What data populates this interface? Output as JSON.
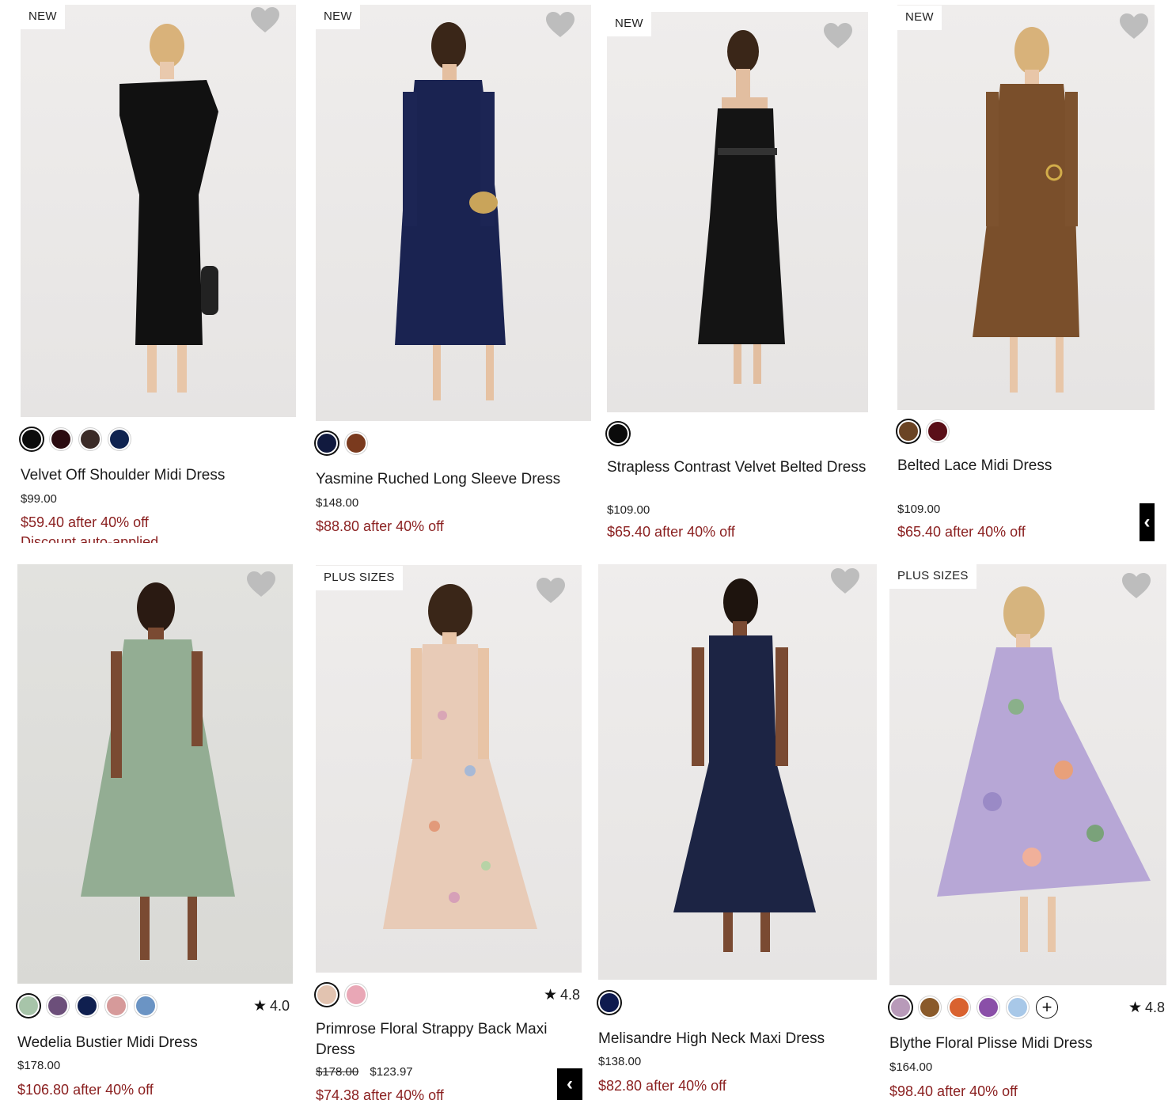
{
  "products": [
    {
      "badge": "NEW",
      "name": "Velvet Off Shoulder Midi Dress",
      "price": "$99.00",
      "sale": "$59.40 after 40% off",
      "extra": "Discount auto-applied",
      "swatches": [
        "#0d0d0d",
        "#2a0b10",
        "#3b2b27",
        "#0f2350"
      ],
      "dress_color": "#101010"
    },
    {
      "badge": "NEW",
      "name": "Yasmine Ruched Long Sleeve Dress",
      "price": "$148.00",
      "sale": "$88.80 after 40% off",
      "swatches": [
        "#111a3f",
        "#7a3a1e"
      ],
      "dress_color": "#1a2351"
    },
    {
      "badge": "NEW",
      "name": "Strapless Contrast Velvet Belted Dress",
      "price": "$109.00",
      "sale": "$65.40 after 40% off",
      "swatches": [
        "#0b0b0b"
      ],
      "dress_color": "#141414"
    },
    {
      "badge": "NEW",
      "name": "Belted Lace Midi Dress",
      "price": "$109.00",
      "sale": "$65.40 after 40% off",
      "swatches": [
        "#6b4424",
        "#5a0f18"
      ],
      "dress_color": "#7a4f2b"
    },
    {
      "badge": "",
      "name": "Wedelia Bustier Midi Dress",
      "price": "$178.00",
      "sale": "$106.80 after 40% off",
      "rating": "4.0",
      "swatches": [
        "#a7c4a9",
        "#6c4f7a",
        "#0f1f4f",
        "#d69a9a",
        "#6b94c4"
      ],
      "dress_color": "#93ad93"
    },
    {
      "badge": "PLUS SIZES",
      "name": "Primrose Floral Strappy Back Maxi Dress",
      "original_price": "$178.00",
      "price": "$123.97",
      "sale": "$74.38 after 40% off",
      "rating": "4.8",
      "swatches": [
        "#e2c3b0",
        "#e9a7b6"
      ],
      "dress_color": "#e8cbb7"
    },
    {
      "badge": "",
      "name": "Melisandre High Neck Maxi Dress",
      "price": "$138.00",
      "sale": "$82.80 after 40% off",
      "swatches": [
        "#0f1b4f"
      ],
      "dress_color": "#1c2444"
    },
    {
      "badge": "PLUS SIZES",
      "name": "Blythe Floral Plisse Midi Dress",
      "price": "$164.00",
      "sale": "$98.40 after 40% off",
      "rating": "4.8",
      "swatches": [
        "#b89ab9",
        "#8a5a2a",
        "#d9622f",
        "#8a4fa8",
        "#a8c8e8"
      ],
      "more_label": "+",
      "dress_color": "#b7a7d6"
    }
  ],
  "icons": {
    "wishlist": "heart-icon",
    "rating": "star-icon",
    "star_glyph": "★",
    "chat": "chat-icon"
  },
  "chat_glyph": "‹"
}
